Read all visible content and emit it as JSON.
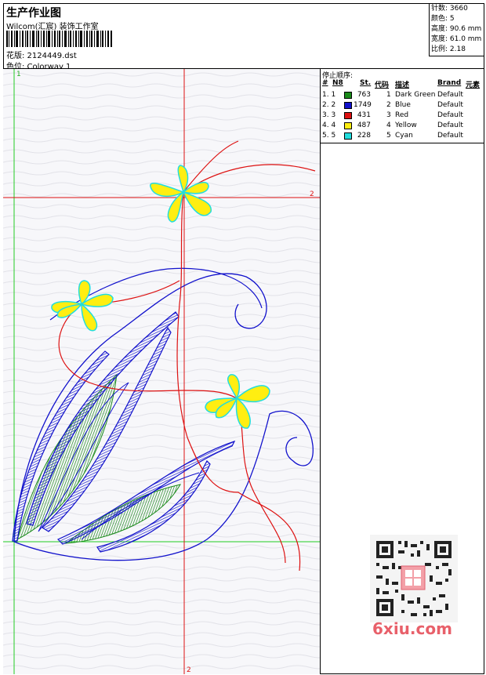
{
  "header": {
    "title": "生产作业图",
    "company": "Wilcom(汇宸) 装饰工作室",
    "design_label": "花版: 2124449.dst",
    "colorway_label": "色位:  Colorway 1"
  },
  "stats": {
    "stitches": "针数:  3660",
    "colors": "颜色:  5",
    "height": "高度:  90.6 mm",
    "width": "宽度:  61.0 mm",
    "ratio": "比例:  2.18"
  },
  "stop_sequence": {
    "title": "停止顺序:",
    "headers": {
      "hash": "#",
      "n": "N8",
      "st": "St.",
      "code": "代码",
      "desc": "描述",
      "brand": "Brand",
      "elem": "元素"
    },
    "rows": [
      {
        "idx": "1. 1",
        "color": "#1a8a1a",
        "st": "763",
        "code": "1",
        "desc": "Dark Green",
        "brand": "Default"
      },
      {
        "idx": "2. 2",
        "color": "#1111cc",
        "st": "1749",
        "code": "2",
        "desc": "Blue",
        "brand": "Default"
      },
      {
        "idx": "3. 3",
        "color": "#dd1111",
        "st": "431",
        "code": "3",
        "desc": "Red",
        "brand": "Default"
      },
      {
        "idx": "4. 4",
        "color": "#ffee11",
        "st": "487",
        "code": "4",
        "desc": "Yellow",
        "brand": "Default"
      },
      {
        "idx": "5. 5",
        "color": "#22dddd",
        "st": "228",
        "code": "5",
        "desc": "Cyan",
        "brand": "Default"
      }
    ]
  },
  "canvas": {
    "markers": {
      "top_green": "1",
      "right_red": "2",
      "bottom_red": "2"
    }
  },
  "watermark": {
    "site": "6xiu.com"
  },
  "colors": {
    "green": "#1a8a1a",
    "blue": "#1111cc",
    "red": "#dd1111",
    "yellow": "#ffee11",
    "cyan": "#22dddd"
  }
}
